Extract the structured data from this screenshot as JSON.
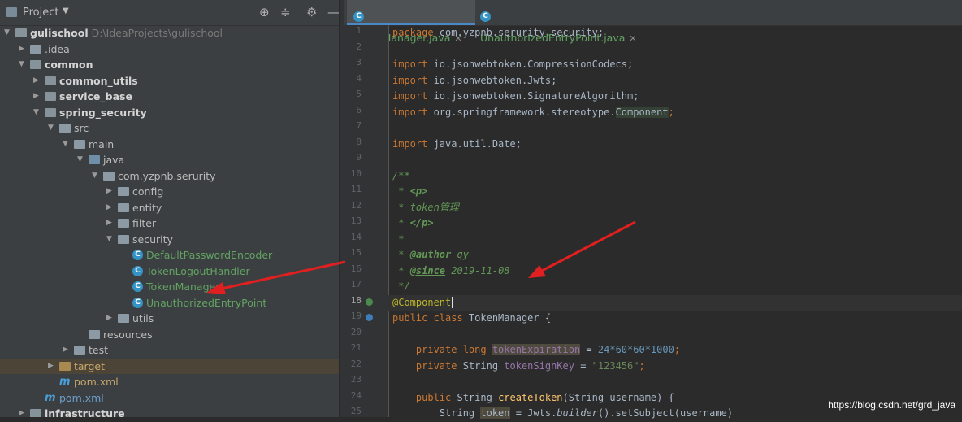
{
  "project_panel": {
    "title": "Project",
    "tree": [
      {
        "label": "gulischool",
        "path": "D:\\IdeaProjects\\gulischool"
      },
      {
        "label": ".idea"
      },
      {
        "label": "common"
      },
      {
        "label": "common_utils"
      },
      {
        "label": "service_base"
      },
      {
        "label": "spring_security"
      },
      {
        "label": "src"
      },
      {
        "label": "main"
      },
      {
        "label": "java"
      },
      {
        "label": "com.yzpnb.serurity"
      },
      {
        "label": "config"
      },
      {
        "label": "entity"
      },
      {
        "label": "filter"
      },
      {
        "label": "security"
      },
      {
        "label": "DefaultPasswordEncoder"
      },
      {
        "label": "TokenLogoutHandler"
      },
      {
        "label": "TokenManager"
      },
      {
        "label": "UnauthorizedEntryPoint"
      },
      {
        "label": "utils"
      },
      {
        "label": "resources"
      },
      {
        "label": "test"
      },
      {
        "label": "target"
      },
      {
        "label": "pom.xml"
      },
      {
        "label": "pom.xml"
      },
      {
        "label": "infrastructure"
      }
    ]
  },
  "editor": {
    "tabs": [
      {
        "label": "TokenManager.java"
      },
      {
        "label": "UnauthorizedEntryPoint.java"
      }
    ],
    "line_numbers": [
      "1",
      "2",
      "3",
      "4",
      "5",
      "6",
      "7",
      "8",
      "9",
      "10",
      "11",
      "12",
      "13",
      "14",
      "15",
      "16",
      "17",
      "18",
      "19",
      "20",
      "21",
      "22",
      "23",
      "24",
      "25"
    ],
    "code": {
      "l1_kw": "package",
      "l1_rest": " com.yzpnb.serurity.security;",
      "l3_kw": "import",
      "l3_rest": " io.jsonwebtoken.CompressionCodecs;",
      "l4_kw": "import",
      "l4_rest": " io.jsonwebtoken.Jwts;",
      "l5_kw": "import",
      "l5_rest": " io.jsonwebtoken.SignatureAlgorithm;",
      "l6_kw": "import",
      "l6_rest": " org.springframework.stereotype.",
      "l6_cls": "Component",
      "l6_end": ";",
      "l8_kw": "import",
      "l8_rest": " java.util.Date;",
      "l10": "/**",
      "l11_pre": " * ",
      "l11_tag": "<p>",
      "l12": " * token管理",
      "l13_pre": " * ",
      "l13_tag": "</p>",
      "l14": " *",
      "l15_pre": " * ",
      "l15_tag": "@author",
      "l15_val": " qy",
      "l16_pre": " * ",
      "l16_tag": "@since",
      "l16_val": " 2019-11-08",
      "l17": " */",
      "l18": "@Component",
      "l19_kw": "public class",
      "l19_rest": " TokenManager {",
      "l21_kw": "    private long ",
      "l21_fld": "tokenExpiration",
      "l21_op": " = ",
      "l21_num": "24*60*60*1000",
      "l21_end": ";",
      "l22_kw": "    private ",
      "l22_type": "String ",
      "l22_fld": "tokenSignKey",
      "l22_op": " = ",
      "l22_str": "\"123456\"",
      "l22_end": ";",
      "l24_kw": "    public ",
      "l24_type": "String ",
      "l24_fn": "createToken",
      "l24_rest": "(String username) {",
      "l25_pre": "        String ",
      "l25_var": "token",
      "l25_rest": " = Jwts.",
      "l25_it": "builder",
      "l25_end": "().setSubject(username)"
    }
  },
  "watermark": "https://blog.csdn.net/grd_java",
  "colors": {
    "arrow": "#e02020",
    "accent": "#4a88c7"
  }
}
